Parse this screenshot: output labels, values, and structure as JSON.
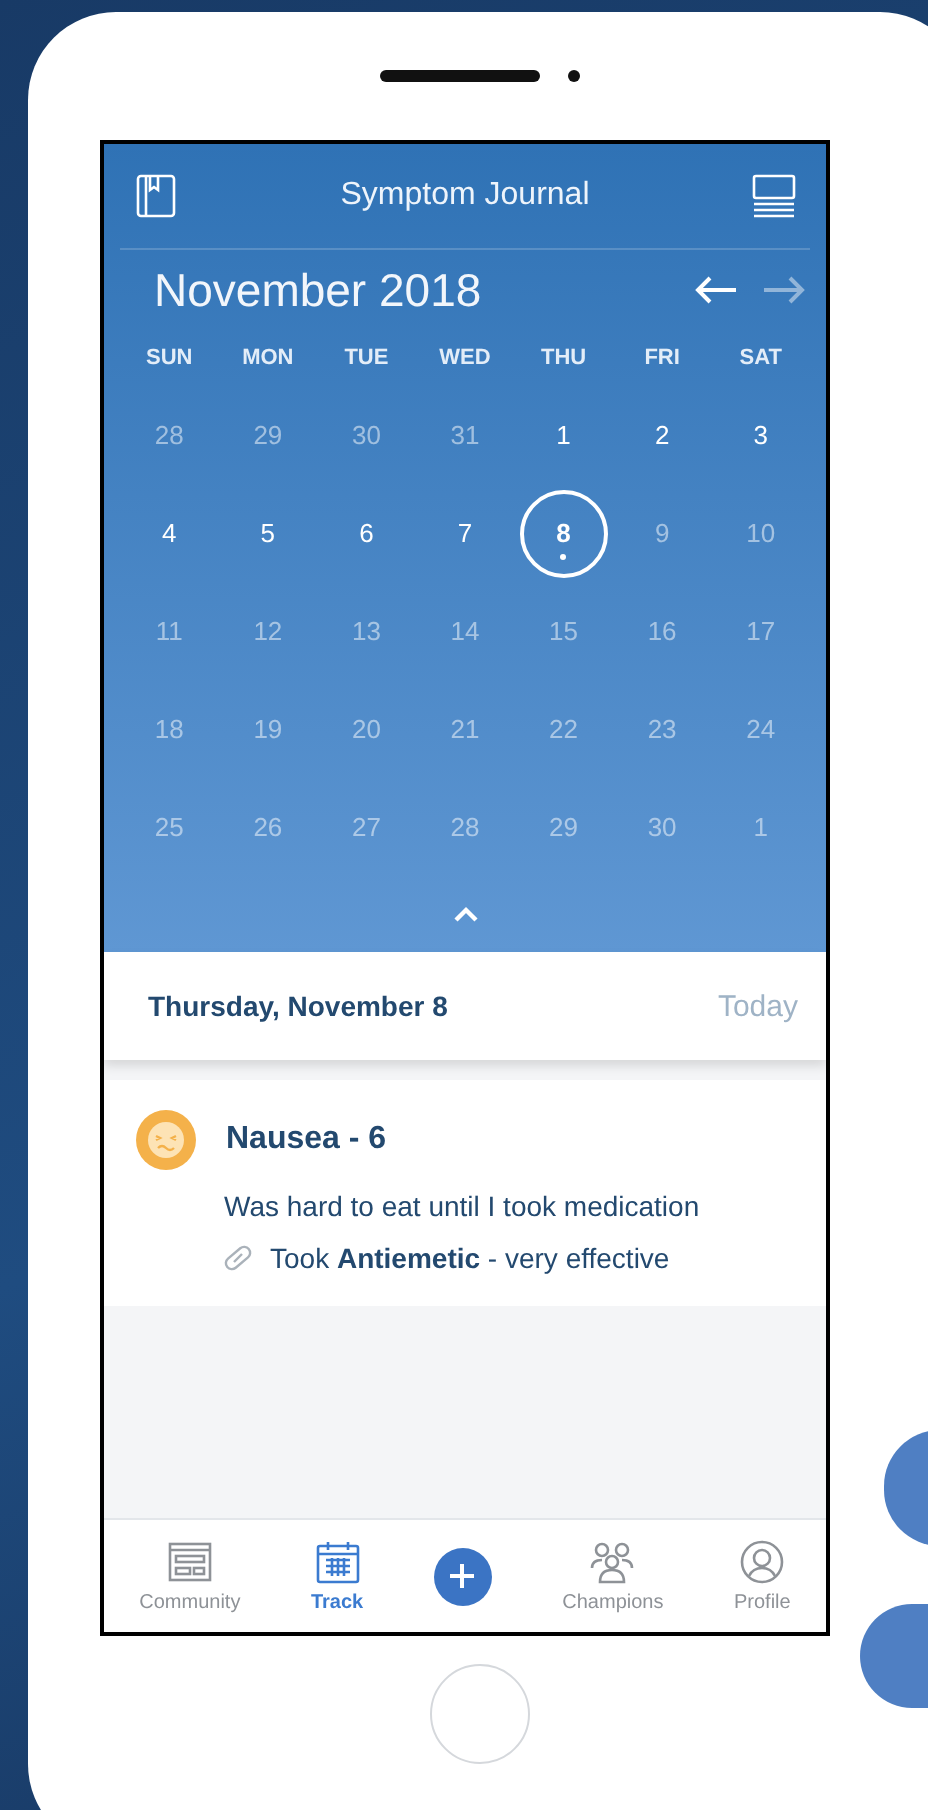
{
  "header": {
    "title": "Symptom Journal"
  },
  "calendar": {
    "month": "November 2018",
    "prev_enabled": true,
    "next_enabled": false,
    "weekdays": [
      "SUN",
      "MON",
      "TUE",
      "WED",
      "THU",
      "FRI",
      "SAT"
    ],
    "weeks": [
      [
        {
          "label": "28",
          "muted": true,
          "selected": false,
          "has_entry": false
        },
        {
          "label": "29",
          "muted": true,
          "selected": false,
          "has_entry": false
        },
        {
          "label": "30",
          "muted": true,
          "selected": false,
          "has_entry": false
        },
        {
          "label": "31",
          "muted": true,
          "selected": false,
          "has_entry": false
        },
        {
          "label": "1",
          "muted": false,
          "selected": false,
          "has_entry": false
        },
        {
          "label": "2",
          "muted": false,
          "selected": false,
          "has_entry": false
        },
        {
          "label": "3",
          "muted": false,
          "selected": false,
          "has_entry": false
        }
      ],
      [
        {
          "label": "4",
          "muted": false,
          "selected": false,
          "has_entry": false
        },
        {
          "label": "5",
          "muted": false,
          "selected": false,
          "has_entry": false
        },
        {
          "label": "6",
          "muted": false,
          "selected": false,
          "has_entry": false
        },
        {
          "label": "7",
          "muted": false,
          "selected": false,
          "has_entry": false
        },
        {
          "label": "8",
          "muted": false,
          "selected": true,
          "has_entry": true
        },
        {
          "label": "9",
          "muted": true,
          "selected": false,
          "has_entry": false
        },
        {
          "label": "10",
          "muted": true,
          "selected": false,
          "has_entry": false
        }
      ],
      [
        {
          "label": "11",
          "muted": true,
          "selected": false,
          "has_entry": false
        },
        {
          "label": "12",
          "muted": true,
          "selected": false,
          "has_entry": false
        },
        {
          "label": "13",
          "muted": true,
          "selected": false,
          "has_entry": false
        },
        {
          "label": "14",
          "muted": true,
          "selected": false,
          "has_entry": false
        },
        {
          "label": "15",
          "muted": true,
          "selected": false,
          "has_entry": false
        },
        {
          "label": "16",
          "muted": true,
          "selected": false,
          "has_entry": false
        },
        {
          "label": "17",
          "muted": true,
          "selected": false,
          "has_entry": false
        }
      ],
      [
        {
          "label": "18",
          "muted": true,
          "selected": false,
          "has_entry": false
        },
        {
          "label": "19",
          "muted": true,
          "selected": false,
          "has_entry": false
        },
        {
          "label": "20",
          "muted": true,
          "selected": false,
          "has_entry": false
        },
        {
          "label": "21",
          "muted": true,
          "selected": false,
          "has_entry": false
        },
        {
          "label": "22",
          "muted": true,
          "selected": false,
          "has_entry": false
        },
        {
          "label": "23",
          "muted": true,
          "selected": false,
          "has_entry": false
        },
        {
          "label": "24",
          "muted": true,
          "selected": false,
          "has_entry": false
        }
      ],
      [
        {
          "label": "25",
          "muted": true,
          "selected": false,
          "has_entry": false
        },
        {
          "label": "26",
          "muted": true,
          "selected": false,
          "has_entry": false
        },
        {
          "label": "27",
          "muted": true,
          "selected": false,
          "has_entry": false
        },
        {
          "label": "28",
          "muted": true,
          "selected": false,
          "has_entry": false
        },
        {
          "label": "29",
          "muted": true,
          "selected": false,
          "has_entry": false
        },
        {
          "label": "30",
          "muted": true,
          "selected": false,
          "has_entry": false
        },
        {
          "label": "1",
          "muted": true,
          "selected": false,
          "has_entry": false
        }
      ]
    ]
  },
  "day_bar": {
    "date": "Thursday, November 8",
    "today_link": "Today"
  },
  "entries": [
    {
      "title": "Nausea - 6",
      "note": "Was hard to eat until I took medication",
      "medication": "Took **Antiemetic** - very effective"
    }
  ],
  "tab_bar": [
    {
      "kind": "community",
      "label": "Community",
      "selected": false
    },
    {
      "kind": "track",
      "label": "Track",
      "selected": true
    },
    {
      "kind": "add",
      "selected": false
    },
    {
      "kind": "champions",
      "label": "Champions",
      "selected": false
    },
    {
      "kind": "profile",
      "label": "Profile",
      "selected": false
    }
  ]
}
